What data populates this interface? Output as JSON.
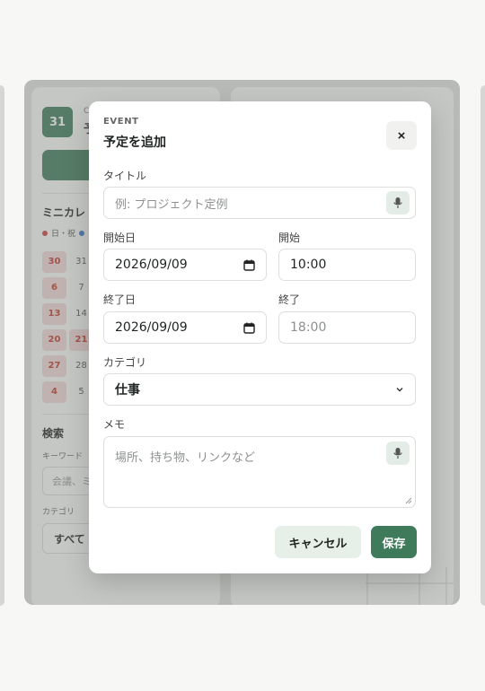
{
  "background": {
    "date_chip": "31",
    "chip_sub": "C",
    "chip_title": "予",
    "mini_calendar_title": "ミニカレ",
    "legend_holiday": "日・祝",
    "mini_calendar_rows": [
      [
        "30",
        "31"
      ],
      [
        "6",
        "7"
      ],
      [
        "13",
        "14"
      ],
      [
        "20",
        "21"
      ],
      [
        "27",
        "28"
      ],
      [
        "4",
        "5"
      ]
    ],
    "search_title": "検索",
    "keyword_label": "キーワード",
    "keyword_placeholder": "会議、ミ",
    "category_label": "カテゴリ",
    "category_value": "すべて"
  },
  "modal": {
    "eyebrow": "EVENT",
    "title": "予定を追加",
    "close_label": "×",
    "title_field": {
      "label": "タイトル",
      "placeholder": "例: プロジェクト定例"
    },
    "start_date": {
      "label": "開始日",
      "value": "2026/09/09"
    },
    "start_time": {
      "label": "開始",
      "value": "10:00"
    },
    "end_date": {
      "label": "終了日",
      "value": "2026/09/09"
    },
    "end_time": {
      "label": "終了",
      "value": "18:00"
    },
    "category": {
      "label": "カテゴリ",
      "value": "仕事"
    },
    "memo": {
      "label": "メモ",
      "placeholder": "場所、持ち物、リンクなど"
    },
    "cancel_label": "キャンセル",
    "save_label": "保存"
  },
  "colors": {
    "accent": "#3f7a5b",
    "accent_soft": "#e7efe9",
    "holiday": "#c0392b"
  },
  "icons": {
    "close": "close-icon",
    "mic": "microphone-icon",
    "calendar": "calendar-icon",
    "chevron": "chevron-down-icon"
  }
}
